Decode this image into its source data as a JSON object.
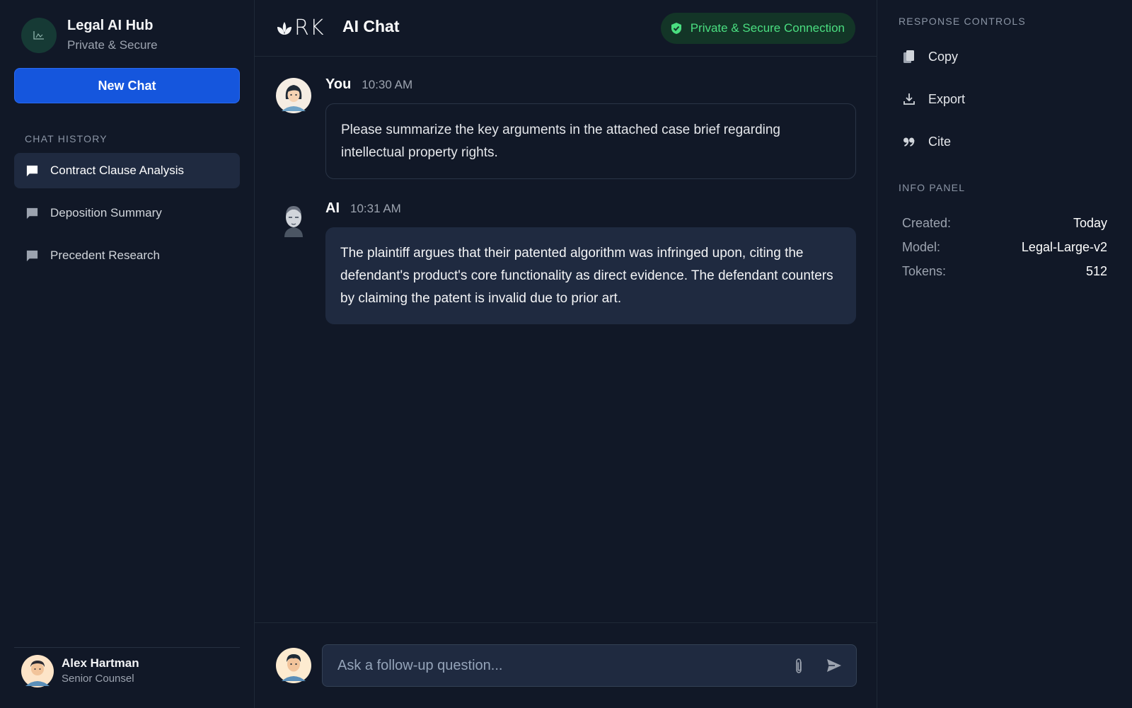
{
  "sidebar": {
    "brand_title": "Legal AI Hub",
    "brand_subtitle": "Private & Secure",
    "new_chat_label": "New Chat",
    "history_label": "CHAT HISTORY",
    "history": [
      {
        "label": "Contract Clause Analysis",
        "active": true
      },
      {
        "label": "Deposition Summary",
        "active": false
      },
      {
        "label": "Precedent Research",
        "active": false
      }
    ],
    "user": {
      "name": "Alex Hartman",
      "role": "Senior Counsel"
    }
  },
  "header": {
    "logo_text": "RK",
    "title": "AI Chat",
    "secure_label": "Private & Secure Connection"
  },
  "messages": [
    {
      "author": "You",
      "time": "10:30 AM",
      "text": "Please summarize the key arguments in the attached case brief regarding intellectual property rights."
    },
    {
      "author": "AI",
      "time": "10:31 AM",
      "text": "The plaintiff argues that their patented algorithm was infringed upon, citing the defendant's product's core functionality as direct evidence. The defendant counters by claiming the patent is invalid due to prior art."
    }
  ],
  "composer": {
    "placeholder": "Ask a follow-up question...",
    "value": ""
  },
  "right_panel": {
    "controls_label": "RESPONSE CONTROLS",
    "controls": [
      {
        "label": "Copy",
        "icon": "copy-icon"
      },
      {
        "label": "Export",
        "icon": "download-icon"
      },
      {
        "label": "Cite",
        "icon": "quote-icon"
      }
    ],
    "info_label": "INFO PANEL",
    "info": [
      {
        "key": "Created:",
        "value": "Today"
      },
      {
        "key": "Model:",
        "value": "Legal-Large-v2"
      },
      {
        "key": "Tokens:",
        "value": "512"
      }
    ]
  },
  "colors": {
    "background": "#111827",
    "accent": "#1556dd",
    "active_item": "#1f2a40",
    "secure_green": "#4ade80"
  }
}
